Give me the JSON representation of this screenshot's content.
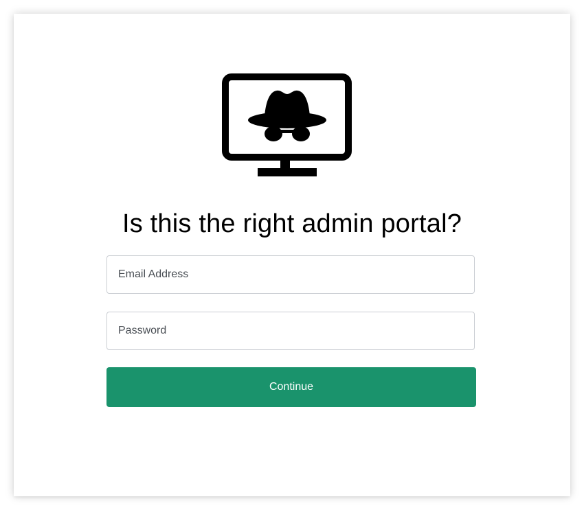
{
  "login": {
    "logo_icon": "incognito-monitor-icon",
    "title": "Is this the right admin portal?",
    "email": {
      "placeholder": "Email Address",
      "value": ""
    },
    "password": {
      "placeholder": "Password",
      "value": ""
    },
    "continue_label": "Continue",
    "accent_color": "#1a936c"
  }
}
